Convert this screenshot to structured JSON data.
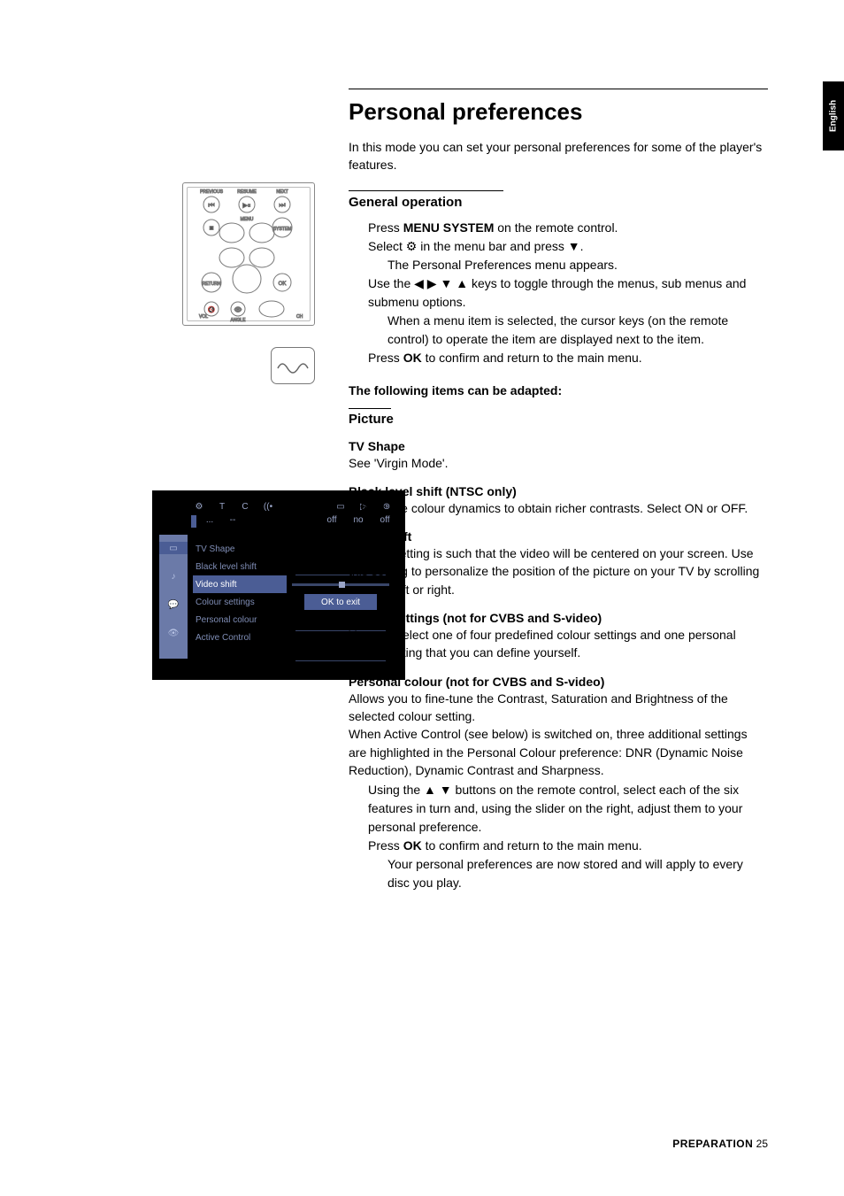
{
  "lang_tab": "English",
  "title": "Personal preferences",
  "intro": "In this mode you can set your personal preferences for some of the player's features.",
  "general": {
    "heading": "General operation",
    "step1_a": "Press ",
    "step1_b": "MENU SYSTEM",
    "step1_c": " on the remote control.",
    "step2": "Select ⚙ in the menu bar and press ▼.",
    "step2_sub": "The Personal Preferences menu appears.",
    "step3": "Use the ◀ ▶ ▼ ▲ keys to toggle through the menus, sub menus and submenu options.",
    "step3_sub": "When a menu item is selected, the cursor keys (on the remote control) to operate the item are displayed next to the item.",
    "step4_a": "Press ",
    "step4_b": "OK",
    "step4_c": " to confirm and return to the main menu."
  },
  "adaptable_heading": "The following items can be adapted:",
  "picture": {
    "heading": "Picture",
    "tvshape_h": "TV Shape",
    "tvshape_t": "See 'Virgin Mode'.",
    "black_h": "Black level shift (NTSC only)",
    "black_t": "Adapts the colour dynamics to obtain richer contrasts. Select ON or OFF.",
    "video_h": "Video shift",
    "video_t": "Factory setting is such that the video will be centered on your screen. Use this setting to personalize the position of the picture on your TV by scrolling it to the left or right.",
    "colset_h": "Colour settings (not for CVBS and S-video)",
    "colset_t": "You can select one of four predefined colour settings and one personal colour setting that you can define yourself.",
    "pcol_h": "Personal colour (not for CVBS and S-video)",
    "pcol_t1": "Allows you to fine-tune the Contrast, Saturation and Brightness of the selected colour setting.",
    "pcol_t2": "When Active Control (see below) is switched on, three additional settings are highlighted in the Personal Colour preference: DNR (Dynamic Noise Reduction), Dynamic Contrast and Sharpness.",
    "pcol_s1": "Using the ▲ ▼ buttons on the remote control, select each of the six features in turn and, using the slider on the right, adjust them to your personal preference.",
    "pcol_s2a": "Press ",
    "pcol_s2b": "OK",
    "pcol_s2c": " to confirm and return to the main menu.",
    "pcol_s2_sub": "Your personal preferences are now stored and will apply to every disc you play."
  },
  "osd": {
    "top_icons": [
      "⚙",
      "T",
      "C",
      "((•",
      "▭",
      "▷",
      "⊕"
    ],
    "tabs_left": [
      "...",
      "--"
    ],
    "tabs_right": [
      "off",
      "no",
      "off"
    ],
    "side_icons": [
      "▭",
      "♪",
      "💬",
      "👁"
    ],
    "list": [
      "TV Shape",
      "Black level shift",
      "Video shift",
      "Colour settings",
      "Personal colour",
      "Active Control"
    ],
    "selected_index": 2,
    "ok_btn": "OK to exit"
  },
  "remote_labels": {
    "prev": "PREVIOUS",
    "playpause": "RESUME",
    "next": "NEXT",
    "stop": "■",
    "menu": "MENU",
    "system": "SYSTEM",
    "ret": "RETURN",
    "ok": "OK",
    "mute": "🔇",
    "vol": "VOL",
    "angle": "ANGLE",
    "ch": "CH"
  },
  "footer": {
    "label": "PREPARATION",
    "page": "25"
  }
}
